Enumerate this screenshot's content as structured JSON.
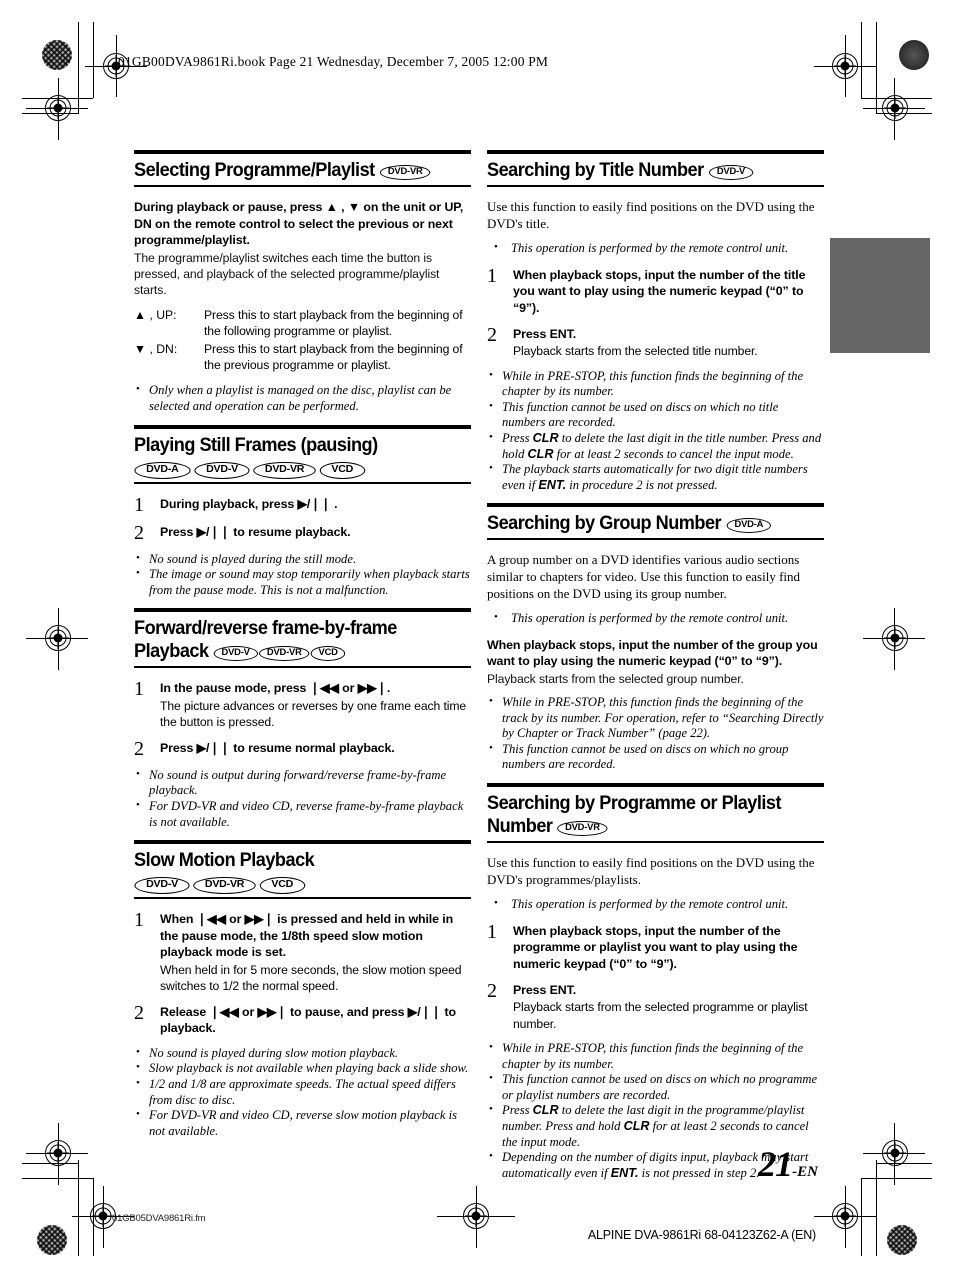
{
  "header": {
    "file_line": "01GB00DVA9861Ri.book  Page 21  Wednesday, December 7, 2005  12:00 PM"
  },
  "footer": {
    "page_number": "21",
    "page_suffix": "-EN",
    "file_name": "01GB05DVA9861Ri.fm",
    "doc_code": "ALPINE DVA-9861Ri 68-04123Z62-A (EN)"
  },
  "left_column": [
    {
      "id": "selecting-programme-playlist",
      "title": "Selecting Programme/Playlist",
      "inline_badges": [
        "DVD-VR"
      ],
      "row_badges": [],
      "lead": "During playback or pause, press ▲ , ▼ on the unit or UP, DN on the remote control to select the previous or next programme/playlist.",
      "plain": "The programme/playlist switches each time the button is pressed, and playback of the selected programme/playlist starts.",
      "deflist": [
        {
          "term": "▲ , UP:",
          "desc": "Press this to start playback from the beginning of the following programme or playlist."
        },
        {
          "term": "▼ , DN:",
          "desc": "Press this to start playback from the beginning of the previous programme or playlist."
        }
      ],
      "steps": [],
      "notes": [
        "Only when a playlist is managed on the disc, playlist can be selected and operation can be performed."
      ]
    },
    {
      "id": "playing-still-frames",
      "title": "Playing Still Frames (pausing)",
      "inline_badges": [],
      "row_badges": [
        "DVD-A",
        "DVD-V",
        "DVD-VR",
        "VCD"
      ],
      "lead": "",
      "plain": "",
      "deflist": [],
      "steps": [
        {
          "num": "1",
          "bold": "During playback, press ▶/❘❘ .",
          "plain": ""
        },
        {
          "num": "2",
          "bold": "Press ▶/❘❘ to resume playback.",
          "plain": ""
        }
      ],
      "notes": [
        "No sound is played during the still mode.",
        "The image or sound may stop temporarily when playback starts from the pause mode. This is not a malfunction."
      ]
    },
    {
      "id": "forward-reverse-frame-by-frame-playback",
      "title": "Forward/reverse frame-by-frame Playback",
      "inline_badges": [
        "DVD-V",
        "DVD-VR",
        "VCD"
      ],
      "row_badges": [],
      "lead": "",
      "plain": "",
      "deflist": [],
      "steps": [
        {
          "num": "1",
          "bold": "In the pause mode, press ❘◀◀ or ▶▶❘.",
          "plain": "The picture advances or reverses by one frame each time the button is pressed."
        },
        {
          "num": "2",
          "bold": "Press ▶/❘❘ to resume normal playback.",
          "plain": ""
        }
      ],
      "notes": [
        "No sound is output during forward/reverse frame-by-frame playback.",
        "For DVD-VR and video CD, reverse frame-by-frame playback is not available."
      ]
    },
    {
      "id": "slow-motion-playback",
      "title": "Slow Motion Playback",
      "inline_badges": [],
      "row_badges": [
        "DVD-V",
        "DVD-VR",
        "VCD"
      ],
      "lead": "",
      "plain": "",
      "deflist": [],
      "steps": [
        {
          "num": "1",
          "bold": "When ❘◀◀ or ▶▶❘ is pressed and held in while in the pause mode, the 1/8th speed slow motion playback mode is set.",
          "plain": "When held in for 5 more seconds, the slow motion speed switches to 1/2 the normal speed."
        },
        {
          "num": "2",
          "bold": "Release ❘◀◀ or ▶▶❘ to pause, and press ▶/❘❘ to playback.",
          "plain": ""
        }
      ],
      "notes": [
        "No sound is played during slow motion playback.",
        "Slow playback is not available when playing back a slide show.",
        "1/2 and 1/8 are approximate speeds. The actual speed differs from disc to disc.",
        "For DVD-VR and video CD, reverse slow motion playback is not available."
      ]
    }
  ],
  "right_column": [
    {
      "id": "searching-by-title-number",
      "title": "Searching by Title Number",
      "inline_badges": [
        "DVD-V"
      ],
      "row_badges": [],
      "serif_intro": "Use this function to easily find positions on the DVD using the DVD's title.",
      "intro_notes": [
        "This operation is performed by the remote control unit."
      ],
      "lead": "",
      "plain": "",
      "steps": [
        {
          "num": "1",
          "bold": "When playback stops, input the number of the title you want to play using the numeric keypad (“0” to “9”).",
          "plain": ""
        },
        {
          "num": "2",
          "bold": "Press ENT.",
          "plain": "Playback starts from the selected title number."
        }
      ],
      "notes": [
        "While in PRE-STOP, this function finds the beginning of the chapter by its number.",
        "This function cannot be used on discs on which no title numbers are recorded.",
        "Press CLR to delete the last digit in the title number. Press and hold CLR for at least 2 seconds to cancel the input mode.",
        "The playback starts automatically for two digit title numbers even if ENT. in procedure 2 is not pressed."
      ]
    },
    {
      "id": "searching-by-group-number",
      "title": "Searching by Group Number",
      "inline_badges": [
        "DVD-A"
      ],
      "row_badges": [],
      "serif_intro": "A group number on a DVD identifies various audio sections similar to chapters for video. Use this function to easily find positions on the DVD using its group number.",
      "intro_notes": [
        "This operation is performed by the remote control unit."
      ],
      "lead": "When playback stops, input the number of the group you want to play using the numeric keypad (“0” to “9”).",
      "plain": "Playback starts from the selected group number.",
      "steps": [],
      "notes": [
        "While in PRE-STOP, this function finds the beginning of the track by its number. For operation, refer to “Searching Directly by Chapter or Track Number” (page 22).",
        "This function cannot be used on discs on which no group numbers are recorded."
      ]
    },
    {
      "id": "searching-by-programme-or-playlist-number",
      "title": "Searching by Programme or Playlist Number",
      "inline_badges": [
        "DVD-VR"
      ],
      "row_badges": [],
      "serif_intro": "Use this function to easily find positions on the DVD using the DVD's programmes/playlists.",
      "intro_notes": [
        "This operation is performed by the remote control unit."
      ],
      "lead": "",
      "plain": "",
      "steps": [
        {
          "num": "1",
          "bold": "When playback stops, input the number of the programme or playlist you want to play using the numeric keypad (“0” to “9”).",
          "plain": ""
        },
        {
          "num": "2",
          "bold": "Press ENT.",
          "plain": "Playback starts from the selected programme or playlist number."
        }
      ],
      "notes": [
        "While in PRE-STOP, this function finds the beginning of the chapter by its number.",
        "This function cannot be used on discs on which no programme or playlist numbers are recorded.",
        "Press CLR to delete the last digit in the programme/playlist number. Press and hold CLR for at least 2 seconds to cancel the input mode.",
        "Depending on the number of digits input, playback may start automatically even if ENT. is not pressed in step 2."
      ]
    }
  ]
}
